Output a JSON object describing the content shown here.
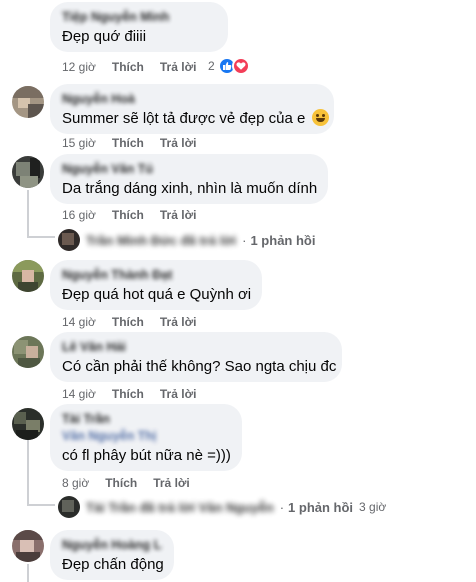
{
  "labels": {
    "like": "Thích",
    "reply": "Trả lời"
  },
  "comments": [
    {
      "name": "Tiệp Nguyễn Minh",
      "text": "Đẹp quớ điiii",
      "time": "12 giờ",
      "react_count": "2",
      "reactions": [
        "like-icon",
        "love-icon"
      ]
    },
    {
      "name": "Nguyễn Hoà",
      "text": "Summer sẽ lột tả được vẻ đẹp của e",
      "time": "15 giờ",
      "emoji": "grinning-face-icon"
    },
    {
      "name": "Nguyễn Văn Tú",
      "text": "Da trắng dáng xinh, nhìn là muốn dính",
      "time": "16 giờ",
      "replies": {
        "name": "Trần Minh Đức đã trả lời",
        "count": "1 phản hồi"
      }
    },
    {
      "name": "Nguyễn Thành Đạt",
      "text": "Đẹp quá hot quá e Quỳnh ơi",
      "time": "14 giờ"
    },
    {
      "name": "Lê Văn Hải",
      "text": "Có cần phải thế không? Sao ngta chịu đc",
      "time": "14 giờ"
    },
    {
      "name": "Tài Trần",
      "tag": "Vân Nguyễn Thị",
      "text": "có fl phây bút nữa nè =)))",
      "time": "8 giờ",
      "replies": {
        "name": "Tài Trần đã trả lời Vân Nguyễn",
        "count": "1 phản hồi",
        "time": "3 giờ"
      }
    },
    {
      "name": "Nguyễn Hoàng Lâm",
      "text": "Đẹp chấn động"
    }
  ],
  "colors": {
    "bubble": "#f0f2f5",
    "meta": "#65676b",
    "like_blue": "#1877f2",
    "love_red": "#f33e58"
  }
}
